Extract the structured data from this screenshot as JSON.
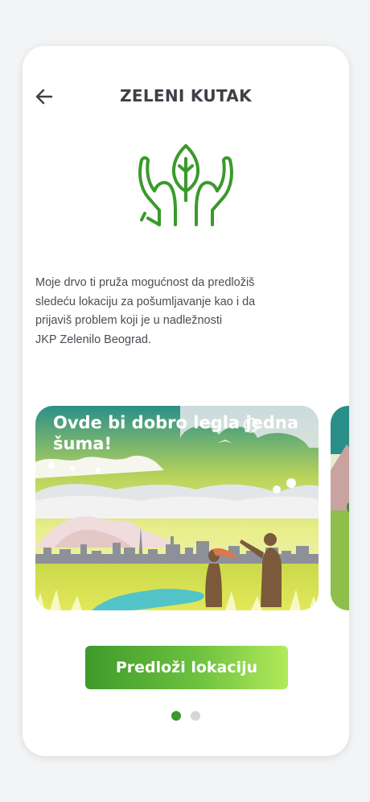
{
  "header": {
    "title": "ZELENI KUTAK",
    "back_icon": "arrow-left-icon"
  },
  "hero": {
    "icon": "hands-leaf-icon",
    "color": "#3a9a2b"
  },
  "description": "Moje drvo ti pruža mogućnost da predložiš\nsledeću lokaciju za pošumljavanje kao i da\nprijaviš problem koji je u nadležnosti\nJKP Zelenilo Beograd.",
  "carousel": {
    "slides": [
      {
        "caption": "Ovde bi dobro legla jedna šuma!"
      }
    ]
  },
  "cta": {
    "label": "Predloži lokaciju"
  },
  "pagination": {
    "count": 2,
    "active_index": 0,
    "active_color": "#3a9a2b",
    "inactive_color": "#d6d6d6"
  }
}
